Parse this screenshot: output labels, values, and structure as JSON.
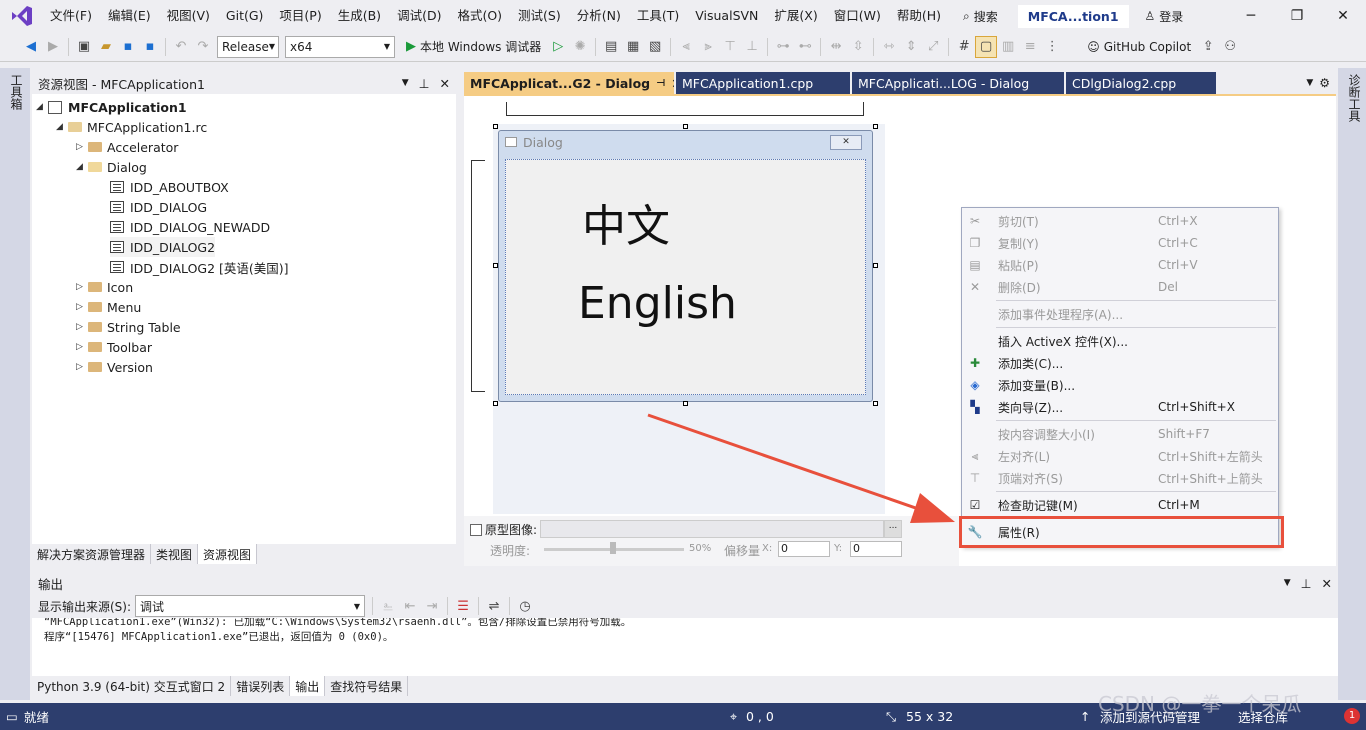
{
  "menu": {
    "items": [
      "文件(F)",
      "编辑(E)",
      "视图(V)",
      "Git(G)",
      "项目(P)",
      "生成(B)",
      "调试(D)",
      "格式(O)",
      "测试(S)",
      "分析(N)",
      "工具(T)",
      "VisualSVN",
      "扩展(X)",
      "窗口(W)",
      "帮助(H)"
    ],
    "search": "搜索",
    "window_title": "MFCA...tion1",
    "login": "登录"
  },
  "toolbar": {
    "configuration": "Release",
    "platform": "x64",
    "run_label": "本地 Windows 调试器",
    "copilot": "GitHub Copilot"
  },
  "left_strip": {
    "label": "工具箱"
  },
  "right_strip": {
    "label": "诊断工具"
  },
  "resource_view": {
    "title": "资源视图 - MFCApplication1",
    "tree": [
      {
        "label": "MFCApplication1",
        "bold": true
      },
      {
        "label": "MFCApplication1.rc"
      },
      {
        "label": "Accelerator"
      },
      {
        "label": "Dialog"
      },
      {
        "label": "IDD_ABOUTBOX"
      },
      {
        "label": "IDD_DIALOG"
      },
      {
        "label": "IDD_DIALOG_NEWADD"
      },
      {
        "label": "IDD_DIALOG2"
      },
      {
        "label": "IDD_DIALOG2 [英语(美国)]"
      },
      {
        "label": "Icon"
      },
      {
        "label": "Menu"
      },
      {
        "label": "String Table"
      },
      {
        "label": "Toolbar"
      },
      {
        "label": "Version"
      }
    ],
    "bottom_tabs": [
      "解决方案资源管理器",
      "类视图",
      "资源视图"
    ]
  },
  "doc_tabs": [
    "MFCApplicat...G2 - Dialog",
    "MFCApplication1.cpp",
    "MFCApplicati...LOG - Dialog",
    "CDlgDialog2.cpp"
  ],
  "dialog": {
    "title": "Dialog",
    "text_cn": "中文",
    "text_en": "English"
  },
  "prototype": {
    "checkbox_label": "原型图像:",
    "opacity_label": "透明度:",
    "opacity_value": "50%",
    "offset_label": "偏移量",
    "x_label": "X:",
    "x_value": "0",
    "y_label": "Y:",
    "y_value": "0"
  },
  "context_menu": {
    "items": [
      {
        "label": "剪切(T)",
        "key": "Ctrl+X",
        "disabled": true,
        "icon": "scissors-icon"
      },
      {
        "label": "复制(Y)",
        "key": "Ctrl+C",
        "disabled": true,
        "icon": "copy-icon"
      },
      {
        "label": "粘贴(P)",
        "key": "Ctrl+V",
        "disabled": true,
        "icon": "paste-icon"
      },
      {
        "label": "删除(D)",
        "key": "Del",
        "disabled": true,
        "icon": "delete-icon"
      },
      {
        "label": "添加事件处理程序(A)...",
        "key": "",
        "disabled": true,
        "icon": ""
      },
      {
        "label": "插入 ActiveX 控件(X)...",
        "key": "",
        "disabled": false,
        "icon": ""
      },
      {
        "label": "添加类(C)...",
        "key": "",
        "disabled": false,
        "icon": "add-class-icon"
      },
      {
        "label": "添加变量(B)...",
        "key": "",
        "disabled": false,
        "icon": "add-variable-icon"
      },
      {
        "label": "类向导(Z)...",
        "key": "Ctrl+Shift+X",
        "disabled": false,
        "icon": "class-wizard-icon"
      },
      {
        "label": "按内容调整大小(I)",
        "key": "Shift+F7",
        "disabled": true,
        "icon": ""
      },
      {
        "label": "左对齐(L)",
        "key": "Ctrl+Shift+左箭头",
        "disabled": true,
        "icon": "align-left-icon"
      },
      {
        "label": "顶端对齐(S)",
        "key": "Ctrl+Shift+上箭头",
        "disabled": true,
        "icon": "align-top-icon"
      },
      {
        "label": "检查助记键(M)",
        "key": "Ctrl+M",
        "disabled": false,
        "icon": "checkbox-icon"
      },
      {
        "label": "属性(R)",
        "key": "",
        "disabled": false,
        "icon": "wrench-icon"
      }
    ]
  },
  "output": {
    "title": "输出",
    "source_label": "显示输出来源(S):",
    "source_value": "调试",
    "lines": [
      "“MFCApplication1.exe”(Win32): 已加载“C:\\Windows\\System32\\rsaenh.dll”。包含/排除设置已禁用符号加载。",
      "程序“[15476] MFCApplication1.exe”已退出，返回值为 0 (0x0)。"
    ],
    "bottom_tabs": [
      "Python 3.9 (64-bit) 交互式窗口 2",
      "错误列表",
      "输出",
      "查找符号结果"
    ]
  },
  "status": {
    "ready": "就绪",
    "position": "0 , 0",
    "size": "55 x 32",
    "add_source": "添加到源代码管理",
    "select_repo": "选择仓库",
    "notification_count": "1"
  },
  "watermark": "CSDN @一拳一个呆瓜",
  "colors": {
    "accent_tab": "#f5cc84",
    "status_bar": "#2d3e6e",
    "highlight": "#e8503c",
    "vs_purple": "#6c3fc4"
  }
}
